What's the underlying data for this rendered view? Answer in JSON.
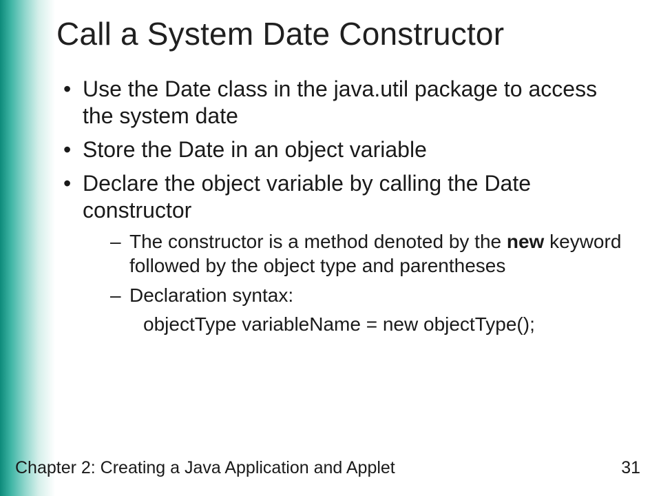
{
  "title": "Call a System Date Constructor",
  "bullets": {
    "b1": "Use the Date class in the java.util package to access the system date",
    "b2": "Store the Date in an object variable",
    "b3": "Declare the object variable by calling the Date constructor",
    "sub1_pre": "The constructor is a method denoted by the ",
    "sub1_bold": "new",
    "sub1_post": " keyword followed by the object type and parentheses",
    "sub2": "Declaration syntax:",
    "code": "objectType variableName = new objectType();"
  },
  "footer": {
    "chapter": "Chapter 2: Creating a Java Application and Applet",
    "page": "31"
  }
}
